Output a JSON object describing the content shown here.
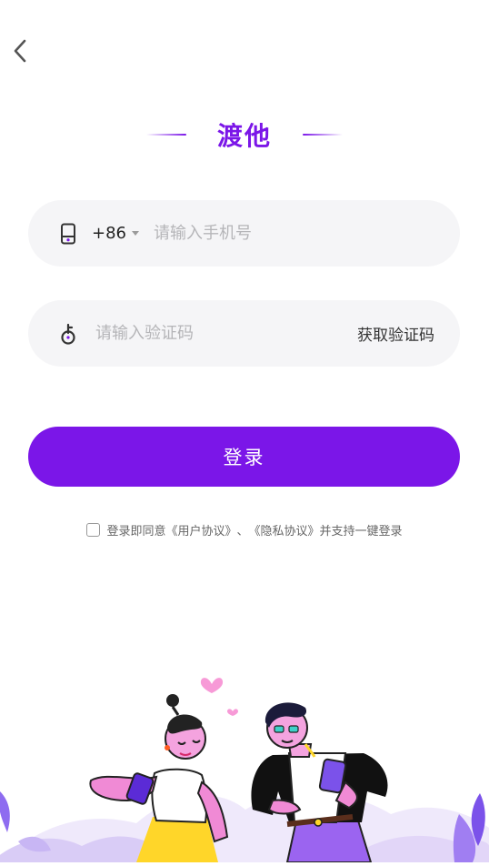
{
  "header": {
    "back_icon": "chevron-left-icon"
  },
  "title": "渡他",
  "phone_field": {
    "icon": "phone-icon",
    "country_code": "+86",
    "placeholder": "请输入手机号",
    "value": ""
  },
  "code_field": {
    "icon": "key-icon",
    "placeholder": "请输入验证码",
    "value": "",
    "get_code_label": "获取验证码"
  },
  "login_label": "登录",
  "agreement": {
    "checked": false,
    "prefix": "登录即同意",
    "user_agreement": "《用户协议》",
    "separator": "、",
    "privacy_agreement": "《隐私协议》",
    "suffix": "并支持一键登录"
  },
  "colors": {
    "accent": "#7b16e8",
    "field_bg": "#f5f5f7",
    "placeholder": "#b5b5b8"
  },
  "illustration": "couple-with-phones-illustration"
}
